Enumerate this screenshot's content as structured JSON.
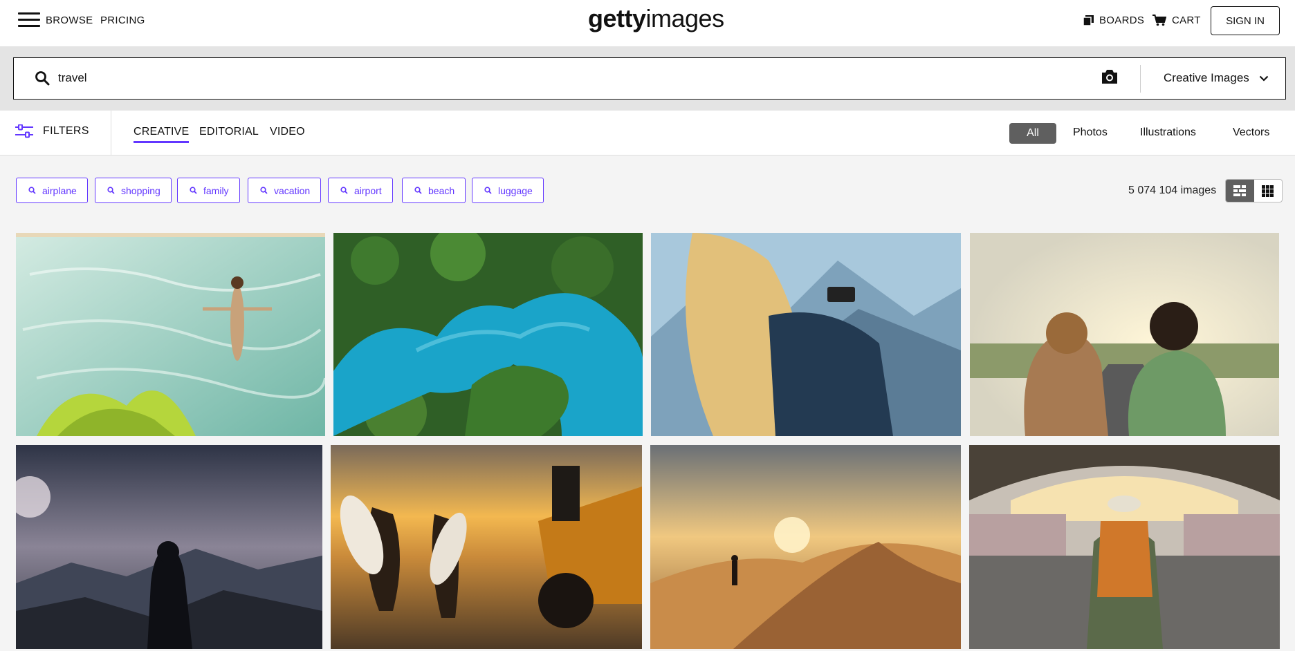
{
  "header": {
    "browse": "BROWSE",
    "pricing": "PRICING",
    "logo_bold": "getty",
    "logo_light": "images",
    "boards": "BOARDS",
    "cart": "CART",
    "sign_in": "SIGN IN"
  },
  "search": {
    "value": "travel",
    "type_label": "Creative Images"
  },
  "filter_bar": {
    "filters": "FILTERS",
    "tabs": [
      "CREATIVE",
      "EDITORIAL",
      "VIDEO"
    ],
    "active_tab": "CREATIVE",
    "types": [
      "All",
      "Photos",
      "Illustrations",
      "Vectors"
    ],
    "active_type": "All"
  },
  "chips": [
    "airplane",
    "shopping",
    "family",
    "vacation",
    "airport",
    "beach",
    "luggage"
  ],
  "result_count": "5 074 104 images",
  "colors": {
    "accent": "#6236ff",
    "active_type_bg": "#5f5f5f"
  },
  "images": [
    {
      "name": "woman-floating-in-pool",
      "colors": [
        "#bfe0d4",
        "#7bbfb0",
        "#b9d84a"
      ]
    },
    {
      "name": "aerial-turquoise-lake",
      "colors": [
        "#2a5a22",
        "#1aa4c9",
        "#4f8a2c"
      ]
    },
    {
      "name": "woman-photographing-mountains",
      "colors": [
        "#9ec2d8",
        "#d8c07a",
        "#2a3f55"
      ]
    },
    {
      "name": "couple-taking-selfie-at-sunset",
      "colors": [
        "#e8dcc0",
        "#6e9a66",
        "#5a5a5a"
      ]
    },
    {
      "name": "hiker-silhouette-misty-mountains",
      "colors": [
        "#5b6477",
        "#1a1d27",
        "#c9b6c0"
      ]
    },
    {
      "name": "surfers-running-at-sunset",
      "colors": [
        "#f0b44c",
        "#3b2a1a",
        "#8d6a3f"
      ]
    },
    {
      "name": "hiker-on-desert-dunes",
      "colors": [
        "#e3b566",
        "#8b5e33",
        "#4c3b2c"
      ]
    },
    {
      "name": "backpacker-at-train-station",
      "colors": [
        "#d9d2c8",
        "#5b5a58",
        "#d07a2a"
      ]
    }
  ]
}
